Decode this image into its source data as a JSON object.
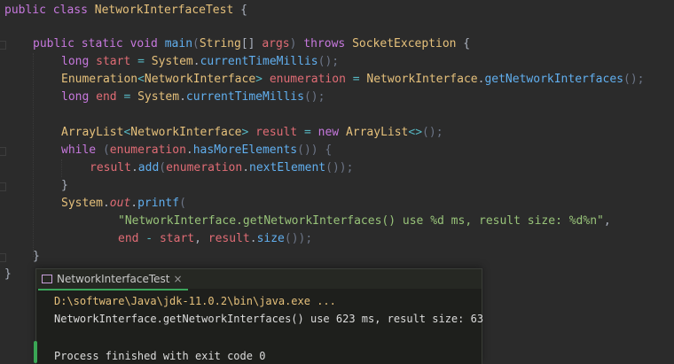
{
  "code": {
    "line1": {
      "kw": "public class ",
      "name": "NetworkInterfaceTest",
      "brace": " {"
    },
    "line2": {
      "kw1": "public static void ",
      "fn": "main",
      "p1": "(",
      "type": "String",
      "p2": "[] ",
      "arg": "args",
      "p3": ") ",
      "kw2": "throws ",
      "exc": "SocketException",
      "p4": " {"
    },
    "line3": {
      "kw": "long ",
      "var": "start",
      "eq": " = ",
      "cls": "System",
      "dot": ".",
      "fn": "currentTimeMillis",
      "end": "();"
    },
    "line4": {
      "type": "Enumeration",
      "lt": "<",
      "gen": "NetworkInterface",
      "gt": "> ",
      "var": "enumeration",
      "eq": " = ",
      "cls": "NetworkInterface",
      "dot": ".",
      "fn": "getNetworkInterfaces",
      "end": "();"
    },
    "line5": {
      "kw": "long ",
      "var": "end",
      "eq": " = ",
      "cls": "System",
      "dot": ".",
      "fn": "currentTimeMillis",
      "end": "();"
    },
    "line7": {
      "type": "ArrayList",
      "lt": "<",
      "gen": "NetworkInterface",
      "gt": "> ",
      "var": "result",
      "eq": " = ",
      "kw": "new ",
      "cls": "ArrayList",
      "diamond": "<>",
      "end": "();"
    },
    "line8": {
      "kw": "while ",
      "p1": "(",
      "var": "enumeration",
      "dot": ".",
      "fn": "hasMoreElements",
      "p2": "()) {"
    },
    "line9": {
      "var": "result",
      "dot": ".",
      "fn": "add",
      "p1": "(",
      "var2": "enumeration",
      "dot2": ".",
      "fn2": "nextElement",
      "p2": "());"
    },
    "line10": {
      "brace": "}"
    },
    "line11": {
      "cls": "System",
      "dot": ".",
      "field": "out",
      "dot2": ".",
      "fn": "printf",
      "p1": "("
    },
    "line12": {
      "str": "\"NetworkInterface.getNetworkInterfaces() use %d ms, result size: %d%n\"",
      "comma": ","
    },
    "line13": {
      "v1": "end",
      "op": " - ",
      "v2": "start",
      "comma": ", ",
      "v3": "result",
      "dot": ".",
      "fn": "size",
      "end": "());"
    },
    "line14": {
      "brace": "}"
    },
    "line15": {
      "brace": "}"
    }
  },
  "run_panel": {
    "tab_label": "NetworkInterfaceTest",
    "tab_close": "×",
    "command": "D:\\software\\Java\\jdk-11.0.2\\bin\\java.exe ...",
    "output": "NetworkInterface.getNetworkInterfaces() use 623 ms, result size: 63",
    "exit": "Process finished with exit code 0"
  },
  "icons": {
    "tab": "run-config-icon",
    "close": "close-icon"
  },
  "colors": {
    "background": "#2b2b2b",
    "keyword": "#c678dd",
    "type": "#e5c07b",
    "method": "#61afef",
    "variable": "#e06c75",
    "string": "#98c379",
    "panel_bg": "#1e1f1c",
    "accent": "#3ba55c"
  }
}
